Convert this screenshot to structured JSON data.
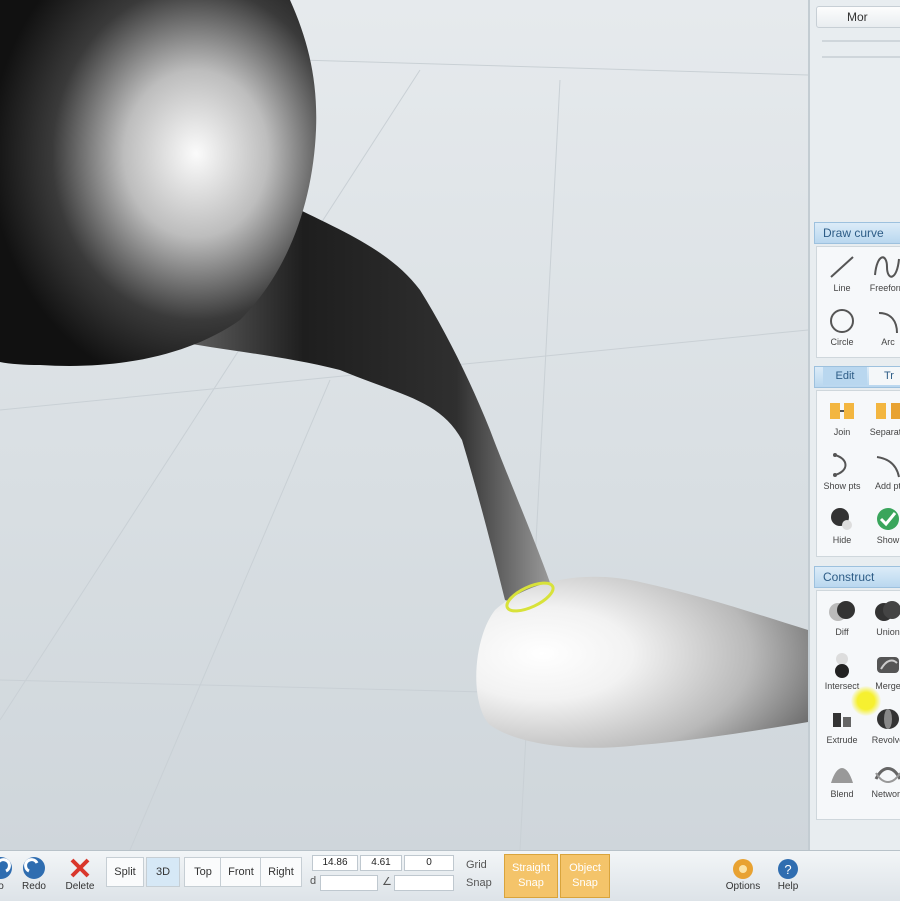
{
  "panel": {
    "title": "Mor"
  },
  "sections": {
    "draw_curve": {
      "header": "Draw curve",
      "tools": [
        {
          "label": "Line",
          "icon": "line-icon"
        },
        {
          "label": "Freeform",
          "icon": "freeform-icon"
        },
        {
          "label": "Circle",
          "icon": "circle-icon"
        },
        {
          "label": "Arc",
          "icon": "arc-icon"
        }
      ]
    },
    "edit": {
      "tabs": [
        "Edit",
        "Tr"
      ],
      "tools": [
        {
          "label": "Join",
          "icon": "join-icon"
        },
        {
          "label": "Separate",
          "icon": "separate-icon"
        },
        {
          "label": "Show pts",
          "icon": "show-points-icon"
        },
        {
          "label": "Add pt",
          "icon": "add-point-icon"
        },
        {
          "label": "Hide",
          "icon": "hide-icon"
        },
        {
          "label": "Show",
          "icon": "show-icon"
        }
      ]
    },
    "construct": {
      "header": "Construct",
      "tools": [
        {
          "label": "Diff",
          "icon": "boolean-difference-icon"
        },
        {
          "label": "Union",
          "icon": "boolean-union-icon"
        },
        {
          "label": "Intersect",
          "icon": "boolean-intersect-icon"
        },
        {
          "label": "Merge",
          "icon": "merge-icon"
        },
        {
          "label": "Extrude",
          "icon": "extrude-icon"
        },
        {
          "label": "Revolve",
          "icon": "revolve-icon"
        },
        {
          "label": "Blend",
          "icon": "blend-icon"
        },
        {
          "label": "Network",
          "icon": "network-icon"
        }
      ]
    }
  },
  "toolbar": {
    "undo_label": "o",
    "redo_label": "Redo",
    "delete_label": "Delete",
    "split_label": "Split",
    "views": [
      "3D",
      "Top",
      "Front",
      "Right"
    ],
    "coord_x": "14.86",
    "coord_y": "4.61",
    "coord_z": "0",
    "coord_d_label": "d",
    "coord_angle_label": "∠",
    "grid_label": "Grid",
    "snap_label": "Snap",
    "straight_snap": "Straight Snap",
    "object_snap": "Object Snap",
    "options_label": "Options",
    "help_label": "Help"
  },
  "colors": {
    "section_header": "#b9d7ef",
    "snap_active": "#f4c46a",
    "selection_highlight": "#d8e23a"
  }
}
